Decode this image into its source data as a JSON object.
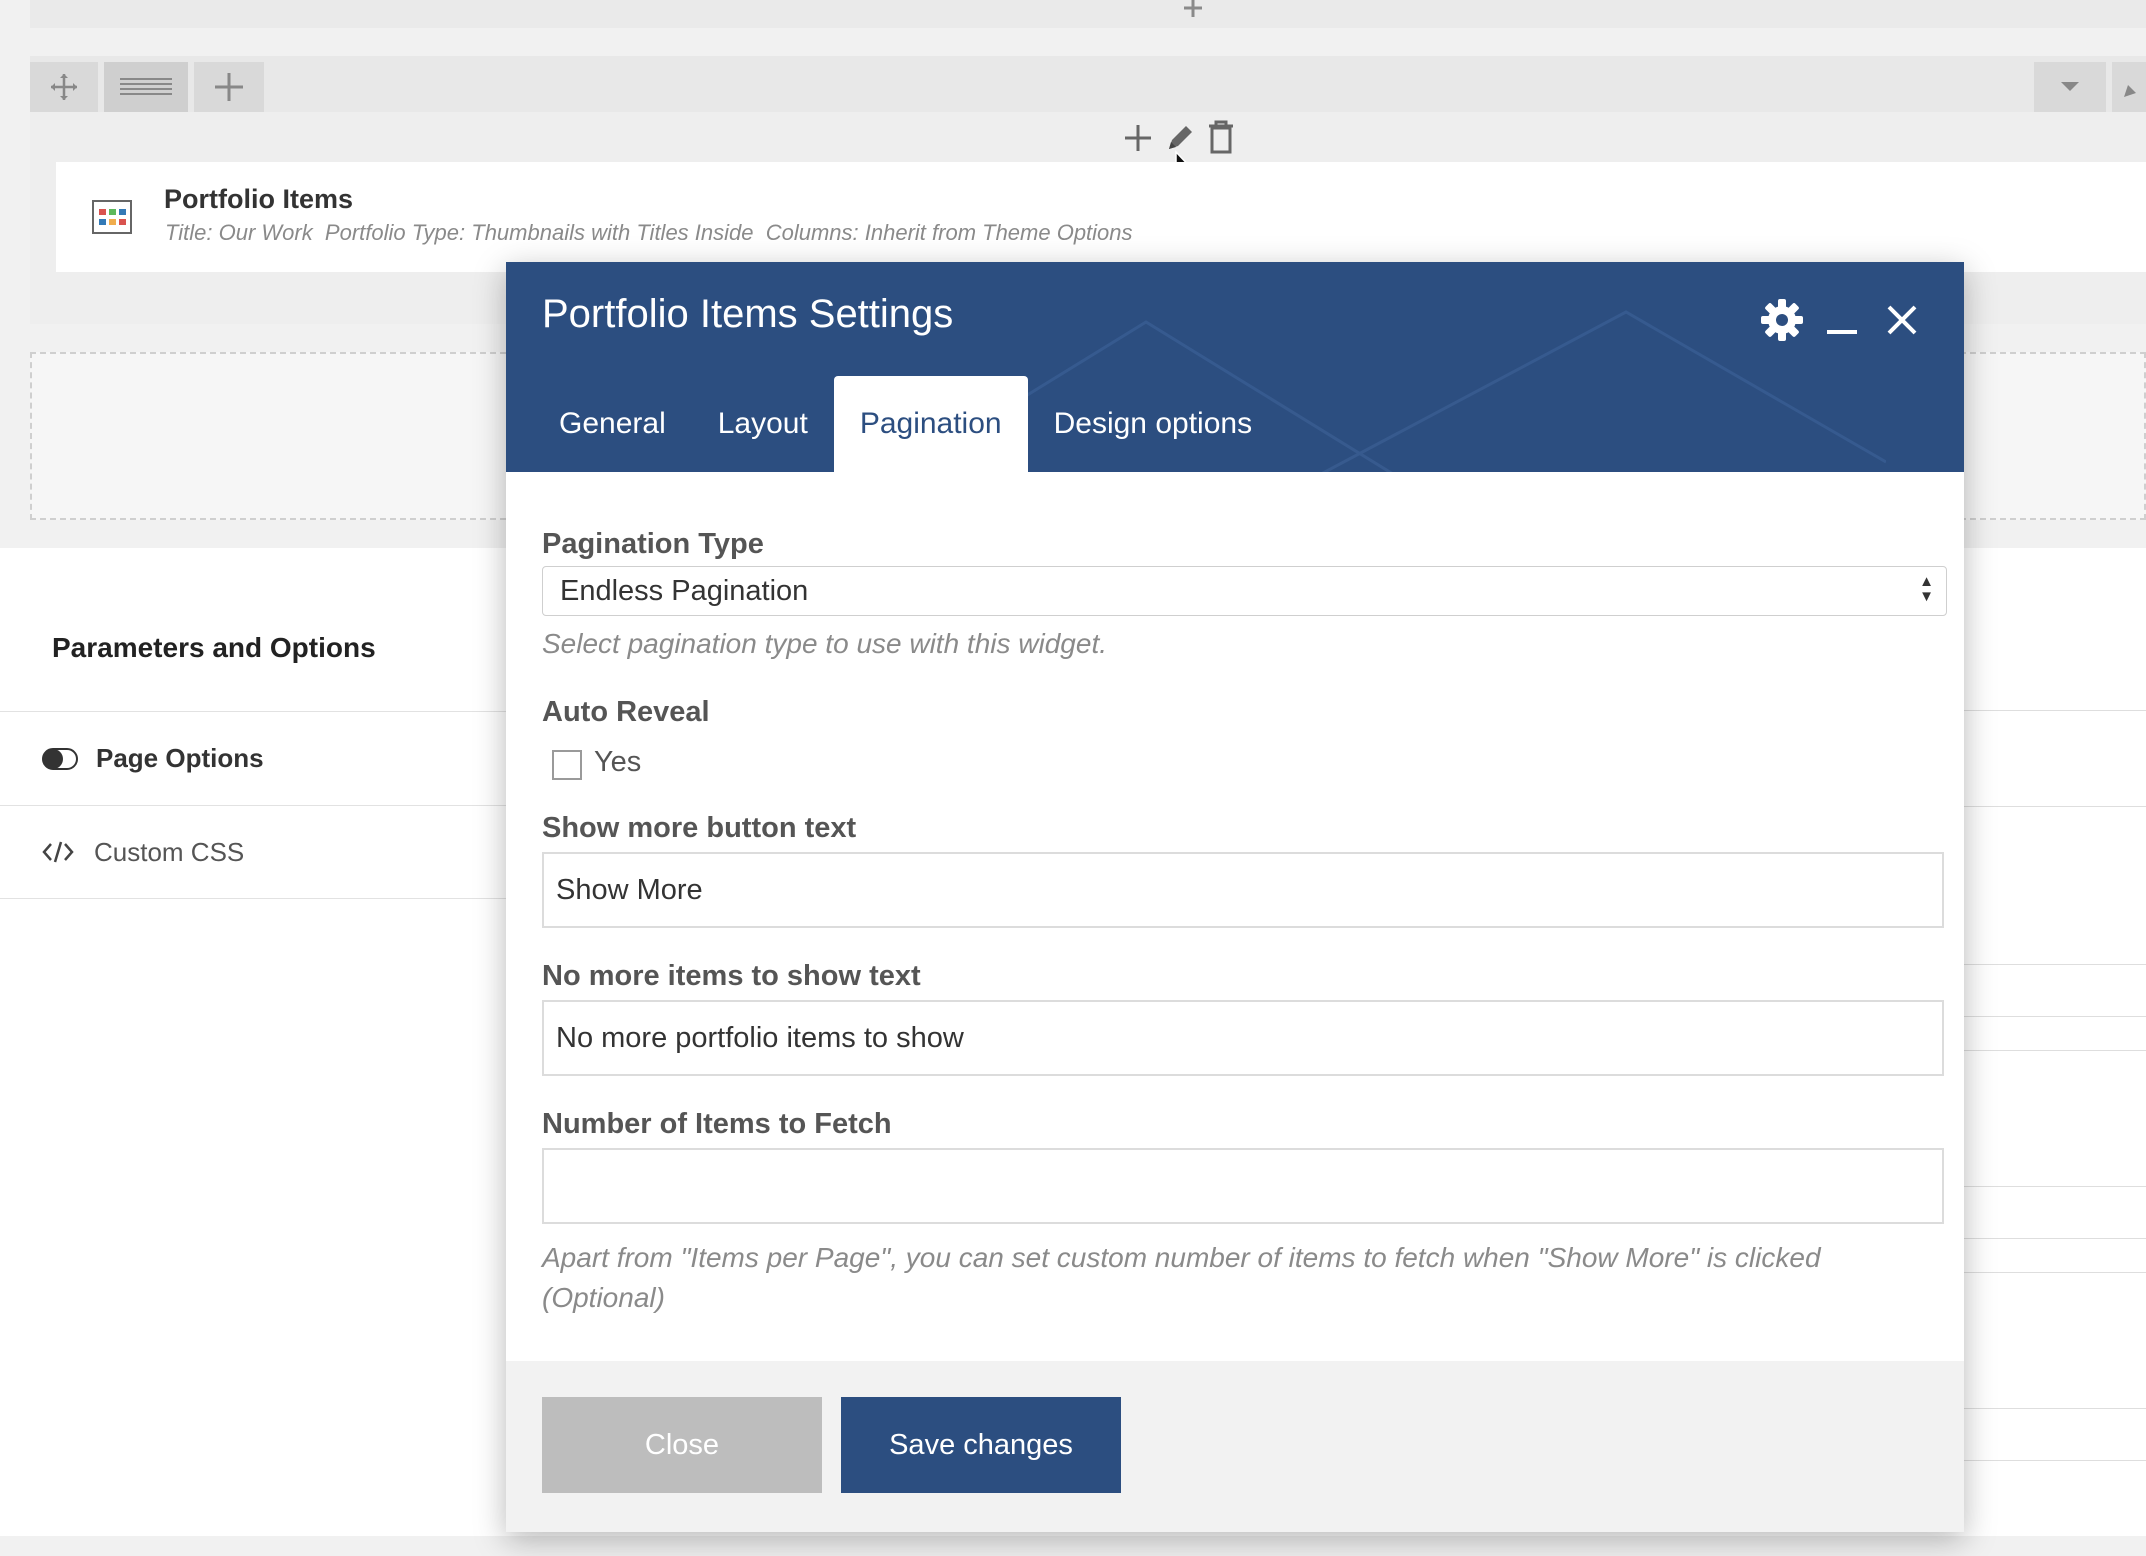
{
  "builder": {
    "element": {
      "title": "Portfolio Items",
      "summary": "Title: Our Work  Portfolio Type: Thumbnails with Titles Inside  Columns: Inherit from Theme Options"
    },
    "toolbar_icons": [
      "move-icon",
      "columns-icon",
      "add-icon",
      "chevron-down-icon",
      "edit-icon"
    ],
    "element_controls": [
      "add-icon",
      "edit-icon",
      "delete-icon"
    ]
  },
  "sidebar": {
    "title": "Parameters and Options",
    "items": [
      {
        "label": "Page Options",
        "icon": "toggle-icon"
      },
      {
        "label": "Custom CSS",
        "icon": "code-icon"
      }
    ]
  },
  "modal": {
    "title": "Portfolio Items Settings",
    "tabs": [
      {
        "label": "General"
      },
      {
        "label": "Layout"
      },
      {
        "label": "Pagination"
      },
      {
        "label": "Design options"
      }
    ],
    "active_tab": "Pagination",
    "fields": {
      "pagination_type": {
        "label": "Pagination Type",
        "value": "Endless Pagination",
        "help": "Select pagination type to use with this widget."
      },
      "auto_reveal": {
        "label": "Auto Reveal",
        "option_label": "Yes",
        "checked": false
      },
      "show_more": {
        "label": "Show more button text",
        "value": "Show More"
      },
      "no_more": {
        "label": "No more items to show text",
        "value": "No more portfolio items to show"
      },
      "items_fetch": {
        "label": "Number of Items to Fetch",
        "value": "",
        "help_line1": "Apart from \"Items per Page\", you can set custom number of items to fetch when \"Show More\" is clicked",
        "help_line2": "(Optional)"
      }
    },
    "buttons": {
      "close": "Close",
      "save": "Save changes"
    }
  },
  "colors": {
    "header": "#2c4e80",
    "primary_button": "#2c4e80",
    "disabled_button": "#bdbdbd"
  }
}
